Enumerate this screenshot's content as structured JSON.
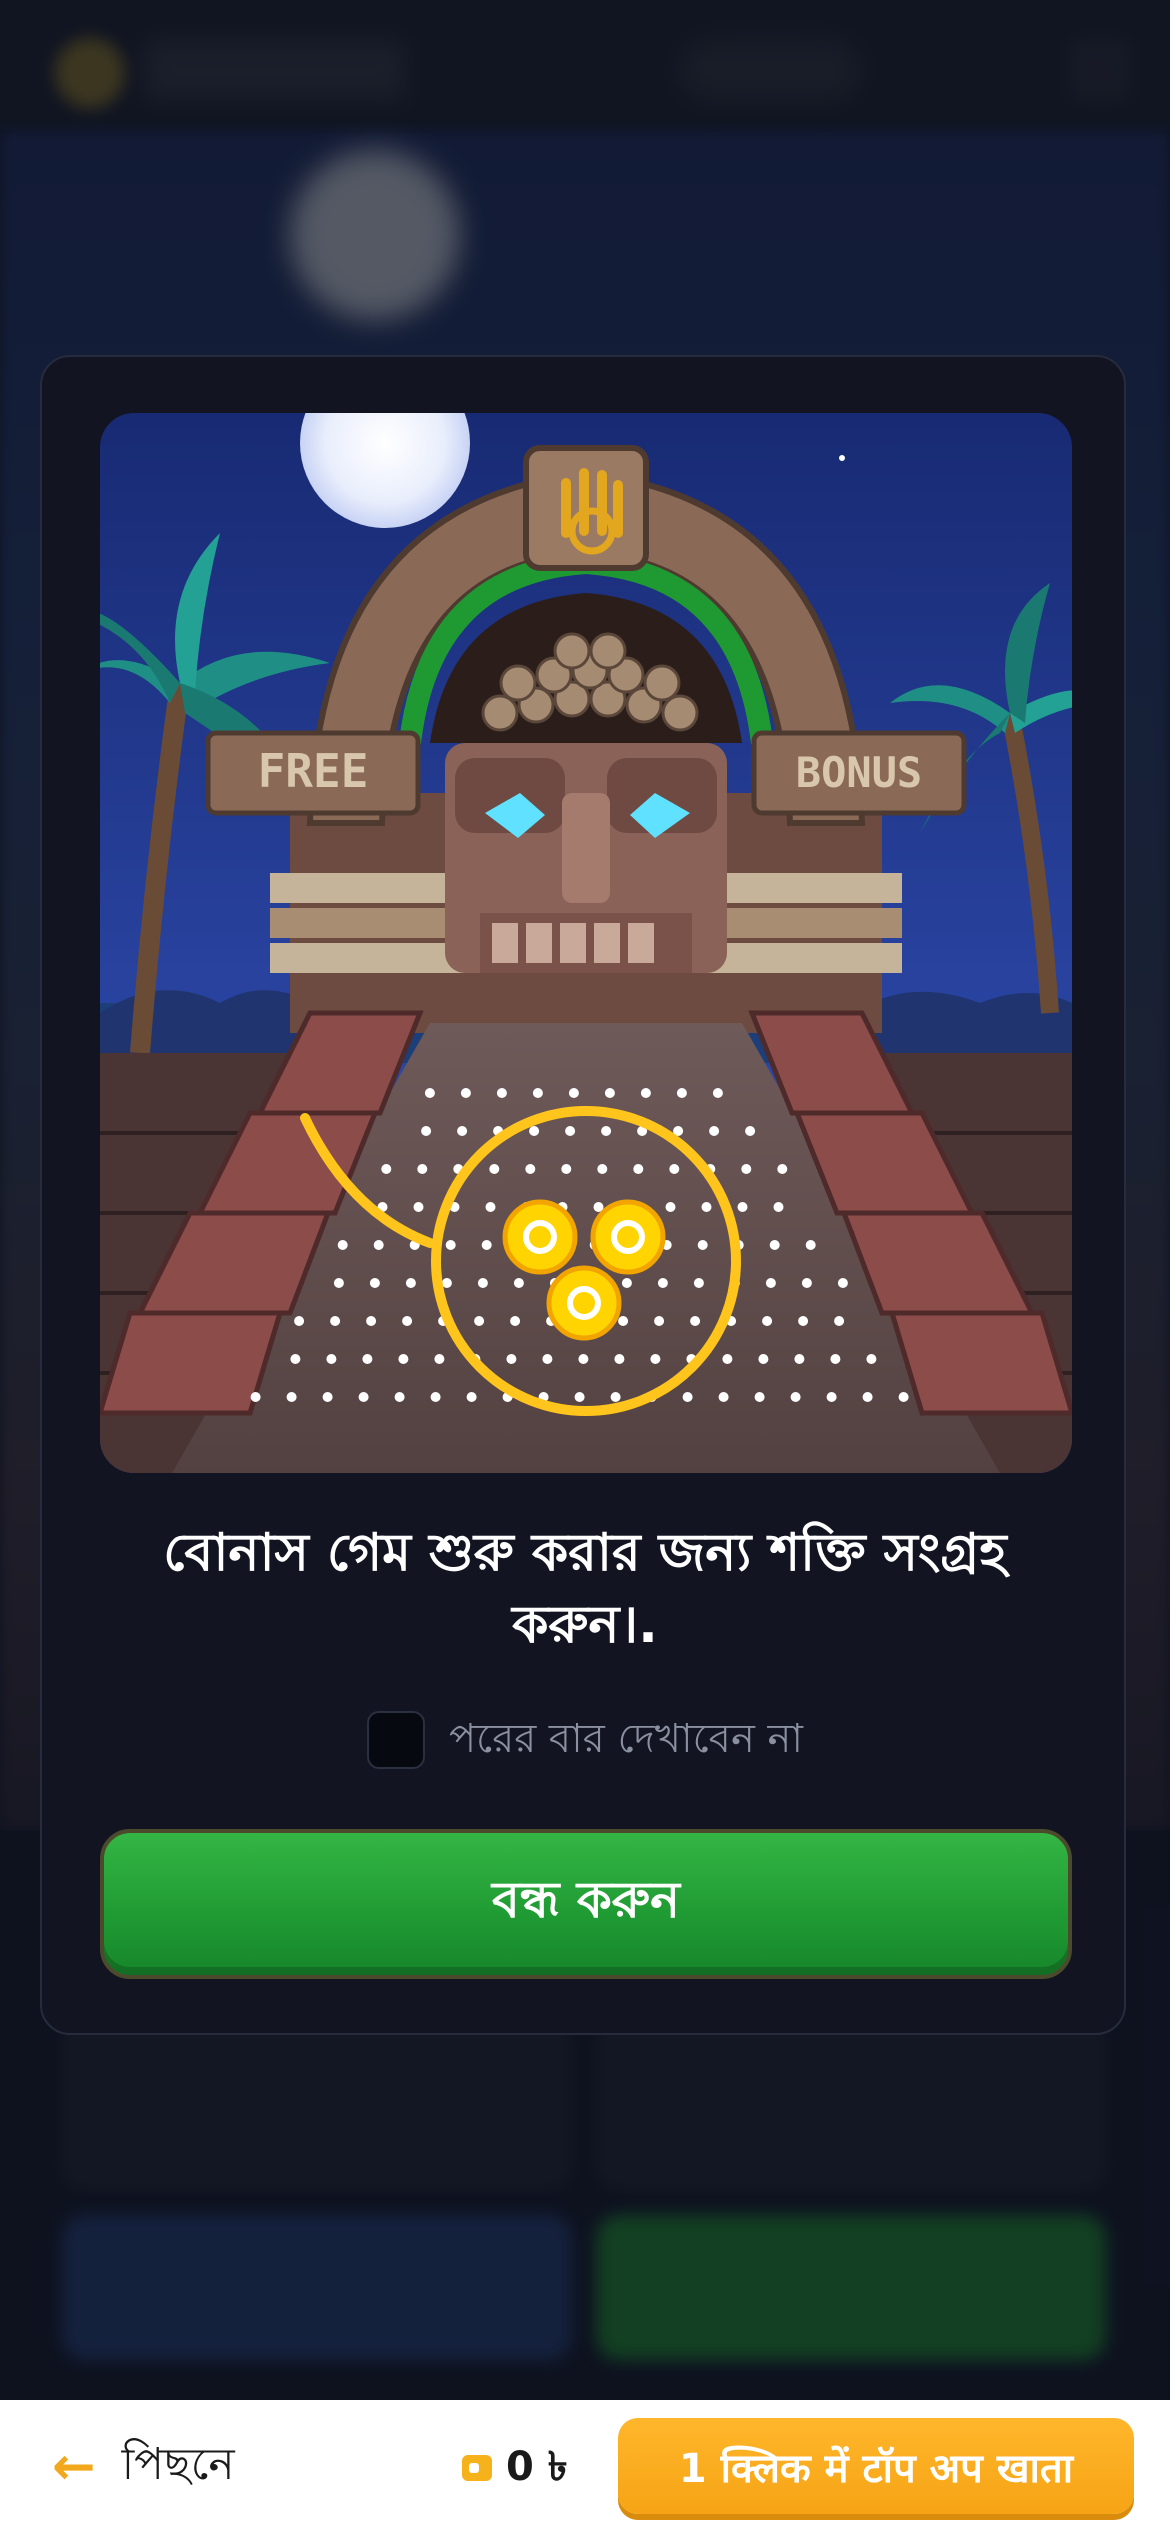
{
  "modal": {
    "message": "বোনাস গেম শুরু করার জন্য শক্তি সংগ্রহ করুন।.",
    "art_labels": {
      "left_sign": "FREE",
      "right_sign": "BONUS"
    },
    "dont_show_label": "পরের বার দেখাবেন না",
    "dont_show_checked": false,
    "close_label": "বন্ধ করুন"
  },
  "bottom_bar": {
    "back_label": "পিছনে",
    "back_icon": "arrow-left-icon",
    "balance": "0 ৳",
    "balance_icon": "wallet-icon",
    "topup_label": "1 क्लिक में टॉप अप खाता"
  },
  "colors": {
    "accent_orange": "#f6a415",
    "close_green": "#1f9a33",
    "modal_bg": "#121521"
  }
}
